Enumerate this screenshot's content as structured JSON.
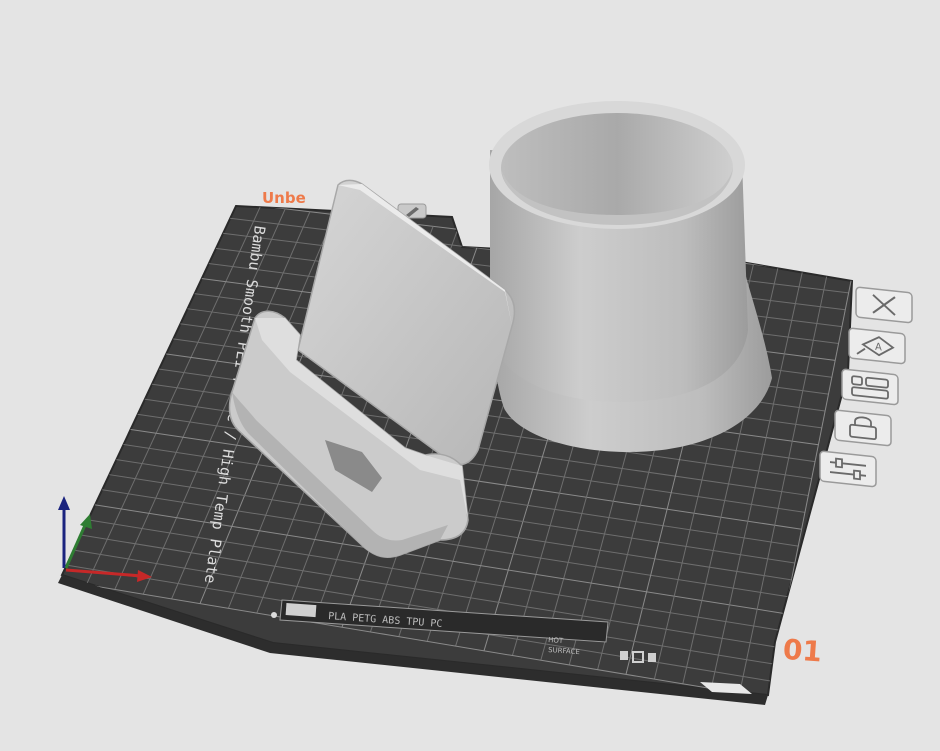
{
  "plate": {
    "name": "Unbe",
    "number": "01",
    "surface_label": "Bambu Smooth PEI Plate / High Temp Plate",
    "filament_strip": "PLA PETG ABS TPU PC",
    "hot_label": "HOT",
    "surface_label_small": "SURFACE"
  },
  "toolbar": {
    "items": [
      {
        "name": "close",
        "icon": "close-icon"
      },
      {
        "name": "auto-orient",
        "icon": "auto-orient-icon"
      },
      {
        "name": "arrange",
        "icon": "arrange-icon"
      },
      {
        "name": "lock",
        "icon": "lock-icon"
      },
      {
        "name": "plate-settings",
        "icon": "settings-icon"
      }
    ]
  },
  "colors": {
    "background": "#e4e4e4",
    "bed": "#3c3c3c",
    "grid": "#6e6e6e",
    "accent": "#ee7a4a",
    "model": "#c4c4c4",
    "axis_x": "#c62828",
    "axis_y": "#2e7d32",
    "axis_z": "#1a237e"
  }
}
